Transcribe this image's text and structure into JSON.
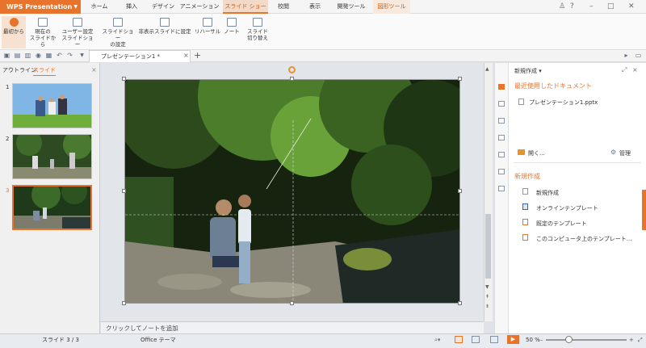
{
  "app": {
    "title": "WPS Presentation"
  },
  "tabs": [
    "ホーム",
    "挿入",
    "デザイン",
    "アニメーション",
    "スライド ショー",
    "校閲",
    "表示",
    "開発ツール",
    "図形ツール"
  ],
  "active_tab": "スライド ショー",
  "ribbon": {
    "from_start": "最初から",
    "from_current_1": "現在の",
    "from_current_2": "スライドから",
    "custom_1": "ユーザー設定",
    "custom_2": "スライドショー",
    "setup_1": "スライドショー",
    "setup_2": "の設定",
    "hide_slide": "非表示スライドに設定",
    "rehearse": "リハーサル",
    "notes": "ノート",
    "transition_1": "スライド",
    "transition_2": "切り替え"
  },
  "document": {
    "tab_label": "プレゼンテーション1 *"
  },
  "left_pane": {
    "tab_outline": "アウトライン",
    "tab_slides": "スライド",
    "slides": [
      {
        "num": "1"
      },
      {
        "num": "2"
      },
      {
        "num": "3"
      }
    ]
  },
  "notes": {
    "placeholder": "クリックしてノートを追加"
  },
  "task_pane": {
    "title": "新規作成",
    "recent_header": "最近使用したドキュメント",
    "recent_file": "プレゼンテーション1.pptx",
    "open_label": "開く...",
    "manage_label": "管理",
    "new_header": "新規作成",
    "items": [
      "新規作成",
      "オンラインテンプレート",
      "既定のテンプレート",
      "このコンピュータ上のテンプレート..."
    ]
  },
  "status": {
    "slide_counter": "スライド 3 / 3",
    "theme": "Office テーマ",
    "zoom": "50 %",
    "zoom_level": 0.5
  },
  "colors": {
    "accent": "#e8742c"
  }
}
